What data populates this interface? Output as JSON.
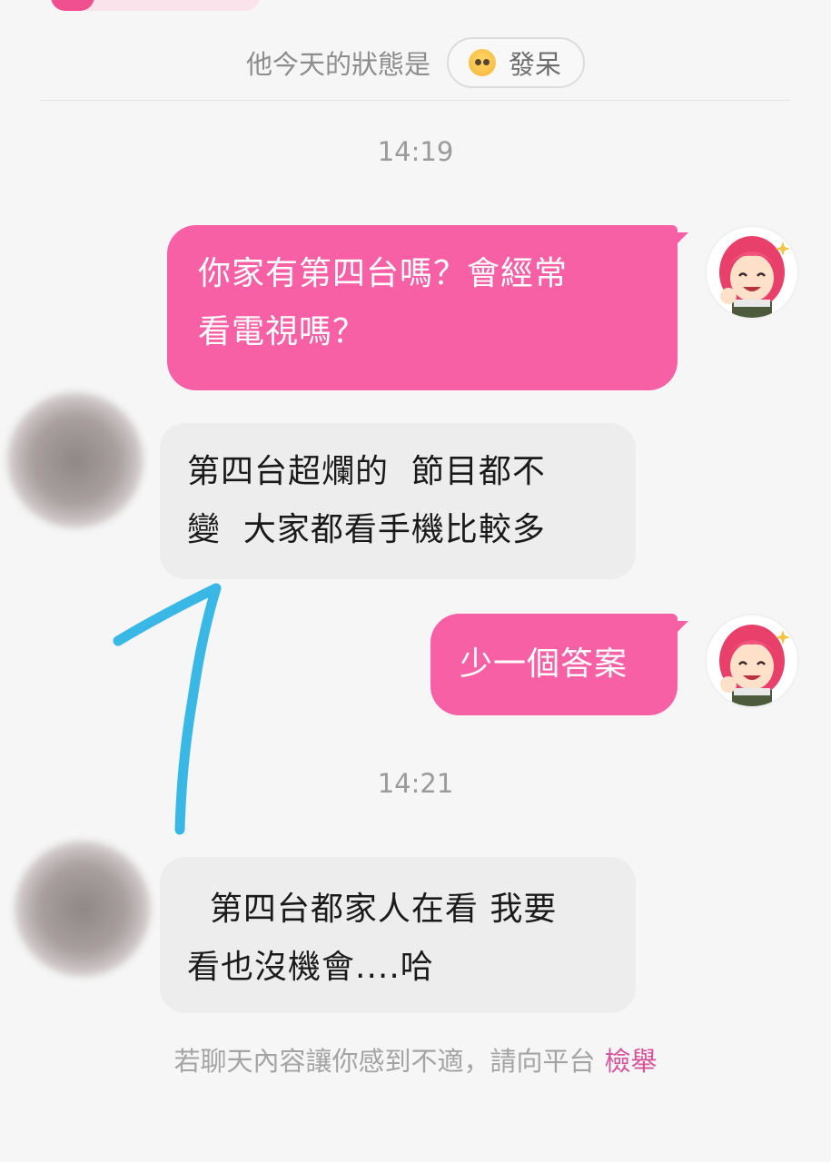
{
  "status": {
    "label": "他今天的狀態是",
    "mood_icon": "dazed-face-icon",
    "mood_text": "發呆"
  },
  "messages": [
    {
      "time": "14:19"
    },
    {
      "side": "out",
      "lines": [
        "你家有第四台嗎？會經常",
        "看電視嗎？"
      ]
    },
    {
      "side": "in",
      "lines": [
        "第四台超爛的  節目都不",
        "變  大家都看手機比較多"
      ]
    },
    {
      "side": "out",
      "lines": [
        "少一個答案"
      ]
    },
    {
      "time": "14:21"
    },
    {
      "side": "in",
      "lines": [
        "  第四台都家人在看 我要",
        "看也沒機會....哈"
      ]
    }
  ],
  "footer": {
    "text": "若聊天內容讓你感到不適，請向平台",
    "report_link": "檢舉"
  },
  "colors": {
    "outgoing_bubble": "#f760a5",
    "incoming_bubble": "#ededed",
    "report_link": "#d6559a",
    "annotation_stroke": "#39b8e6"
  }
}
